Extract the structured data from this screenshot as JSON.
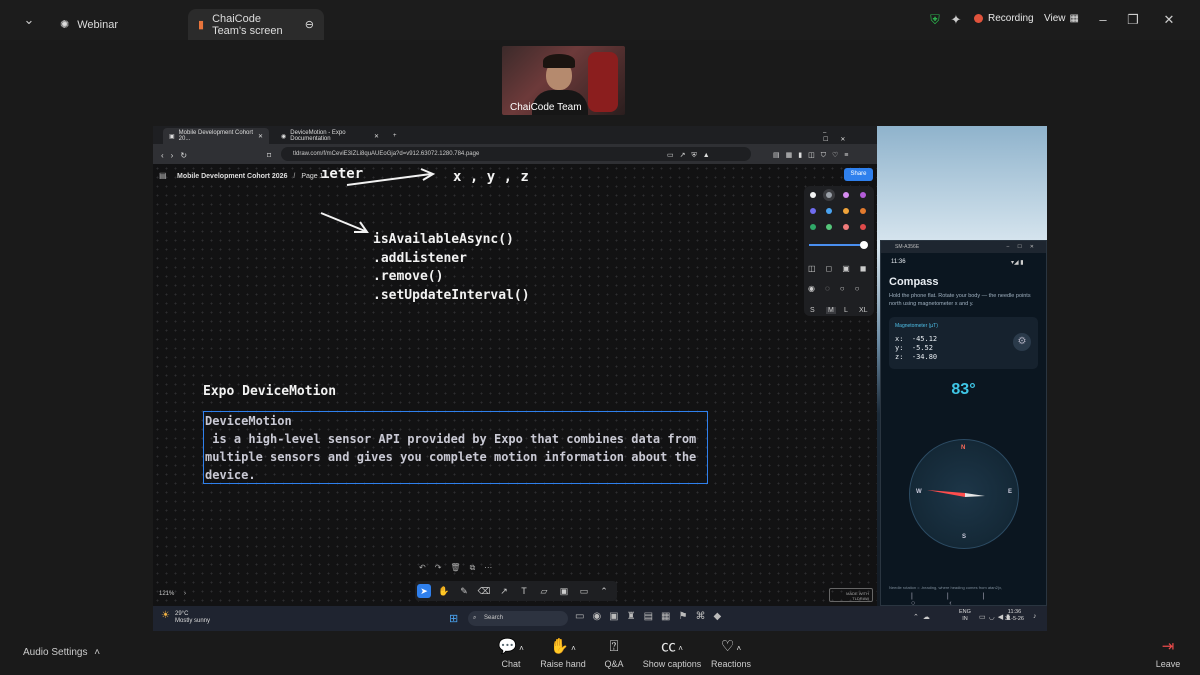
{
  "titlebar": {
    "app_name": "Webinar",
    "share_tab": "ChaiCode Team's screen",
    "recording": "Recording",
    "view": "View",
    "colors": {
      "recording": "#e0533c",
      "shield": "#2bb24c"
    }
  },
  "camera": {
    "name": "ChaiCode Team"
  },
  "browser": {
    "tabs": [
      "Mobile Development Cohort 20...",
      "DeviceMotion - Expo Documentation"
    ],
    "url": "tldraw.com/f/mCeviE3IZLi8quAUEoGja?d=v912.63072.1280.784.page"
  },
  "tldraw": {
    "doc_title": "Mobile Development Cohort 2026",
    "page": "Page 1",
    "share": "Share",
    "top_text_fragment": "ıeter",
    "xyz": "x , y , z",
    "methods": [
      "isAvailableAsync()",
      ".addListener",
      ".remove()",
      ".setUpdateInterval()"
    ],
    "heading": "Expo DeviceMotion",
    "box_title": "DeviceMotion",
    "box_lines": [
      " is a high-level sensor API provided by Expo that combines data from",
      "multiple sensors and gives you complete motion information about the",
      "device."
    ],
    "sizes": [
      "S",
      "M",
      "L",
      "XL"
    ],
    "zoom": "121%",
    "badge": "MADE WITH TLDRAW",
    "accent": "#2f80ed"
  },
  "taskbar": {
    "weather_temp": "29°C",
    "weather_desc": "Mostly sunny",
    "search": "Search",
    "lang": "ENG",
    "region": "IN",
    "time": "11:36",
    "date": "31-5-26"
  },
  "phone": {
    "window_title": "SM-A356E",
    "status_time": "11:36",
    "title": "Compass",
    "desc": "Hold the phone flat. Rotate your body — the needle points north using magnetometer x and y.",
    "mag_label": "Magnetometer (µT)",
    "x": "x:  -45.12",
    "y": "y:  -5.52",
    "z": "z:  -34.80",
    "heading": "83°",
    "north": "N",
    "south": "S",
    "east": "E",
    "west": "W",
    "footer": "Needle rotation = -heading, where heading comes from atan2(x,",
    "heading_color": "#3fc6e6"
  },
  "controls": {
    "audio": "Audio Settings",
    "chat": "Chat",
    "raise": "Raise hand",
    "qa": "Q&A",
    "captions": "Show captions",
    "reactions": "Reactions",
    "leave": "Leave"
  }
}
